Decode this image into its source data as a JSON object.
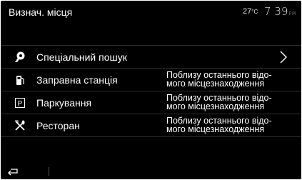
{
  "header": {
    "title": "Визнач. місця",
    "temperature": "27",
    "temperature_unit": "°C",
    "time": "7 39",
    "time_suffix": "PM"
  },
  "menu": {
    "items": [
      {
        "icon": "poi-search-icon",
        "label": "Спеціальний пошук",
        "desc": "",
        "has_chevron": true
      },
      {
        "icon": "fuel-station-icon",
        "label": "Заправна станція",
        "desc": "Поблизу останнього відо-\nмого місцезнаходження"
      },
      {
        "icon": "parking-icon",
        "label": "Паркування",
        "desc": "Поблизу останнього відо-\nмого місцезнаходження"
      },
      {
        "icon": "restaurant-icon",
        "label": "Ресторан",
        "desc": "Поблизу останнього відо-\nмого місцезнаходження"
      }
    ]
  },
  "footer": {
    "back_icon": "back-arrow-icon"
  },
  "colors": {
    "background": "#000000",
    "text": "#ffffff",
    "divider": "#2e2e2e"
  }
}
